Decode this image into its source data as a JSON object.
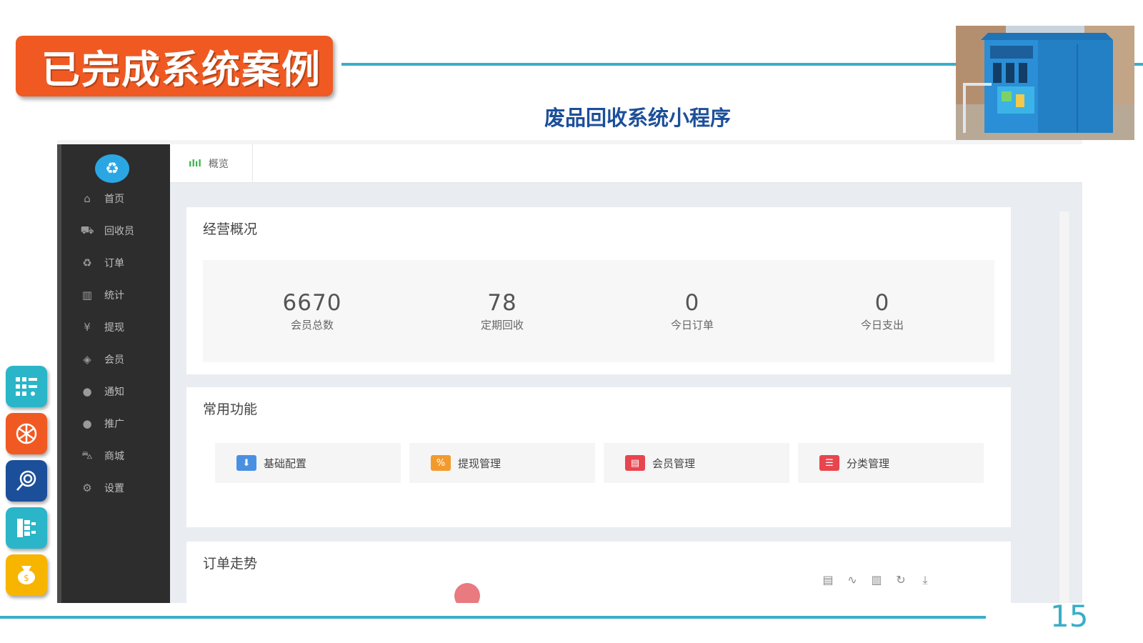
{
  "slide": {
    "title": "已完成系统案例",
    "subtitle": "废品回收系统小程序",
    "page_number": "15",
    "accent_color": "#3aaec8",
    "badge_color": "#f05a22"
  },
  "side_icons": [
    {
      "name": "grid-list-icon",
      "color": "#2bb5c8"
    },
    {
      "name": "globe-icon",
      "color": "#f05a22"
    },
    {
      "name": "touch-icon",
      "color": "#1c4f9a"
    },
    {
      "name": "hierarchy-icon",
      "color": "#2bb5c8"
    },
    {
      "name": "money-bag-icon",
      "color": "#f7b500"
    }
  ],
  "admin": {
    "sidebar": {
      "logo_icon": "recycle-icon",
      "items": [
        {
          "label": "首页",
          "icon": "home-icon"
        },
        {
          "label": "回收员",
          "icon": "truck-icon"
        },
        {
          "label": "订单",
          "icon": "recycle-icon"
        },
        {
          "label": "统计",
          "icon": "bar-chart-icon"
        },
        {
          "label": "提现",
          "icon": "yen-icon"
        },
        {
          "label": "会员",
          "icon": "tag-icon"
        },
        {
          "label": "通知",
          "icon": "comment-icon"
        },
        {
          "label": "推广",
          "icon": "comments-icon"
        },
        {
          "label": "商城",
          "icon": "cart-icon"
        },
        {
          "label": "设置",
          "icon": "gear-icon"
        }
      ]
    },
    "tab": {
      "label": "概览"
    },
    "overview": {
      "title": "经营概况",
      "stats": [
        {
          "value": "6670",
          "label": "会员总数"
        },
        {
          "value": "78",
          "label": "定期回收"
        },
        {
          "value": "0",
          "label": "今日订单"
        },
        {
          "value": "0",
          "label": "今日支出"
        }
      ]
    },
    "functions": {
      "title": "常用功能",
      "items": [
        {
          "label": "基础配置",
          "icon": "download-icon",
          "color": "#4a90e2"
        },
        {
          "label": "提现管理",
          "icon": "cash-icon",
          "color": "#f39a2d"
        },
        {
          "label": "会员管理",
          "icon": "calendar-icon",
          "color": "#e8454f"
        },
        {
          "label": "分类管理",
          "icon": "list-icon",
          "color": "#e8454f"
        }
      ]
    },
    "trend": {
      "title": "订单走势",
      "toolbox": [
        "data-view-icon",
        "line-chart-icon",
        "bar-chart-icon",
        "refresh-icon",
        "save-image-icon"
      ]
    }
  }
}
